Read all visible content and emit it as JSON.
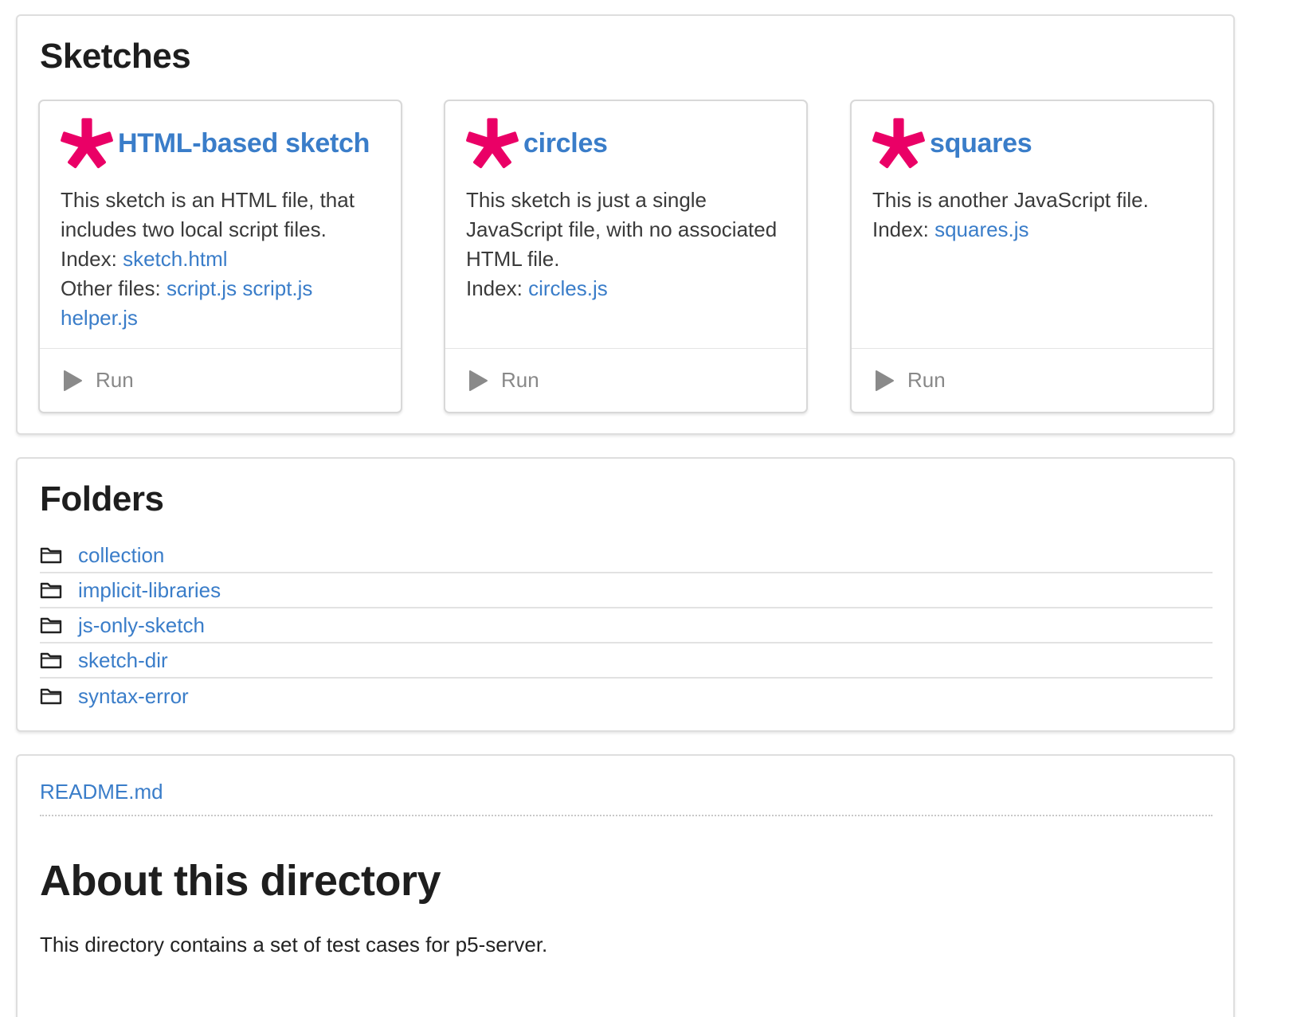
{
  "sketches": {
    "title": "Sketches",
    "cards": [
      {
        "title": "HTML-based sketch",
        "description": "This sketch is an HTML file, that includes two local script files.",
        "index_label": "Index:",
        "index_file": "sketch.html",
        "other_label": "Other files:",
        "other_files": [
          "script.js",
          "script.js",
          "helper.js"
        ],
        "run_label": "Run"
      },
      {
        "title": "circles",
        "description": "This sketch is just a single JavaScript file, with no associated HTML file.",
        "index_label": "Index:",
        "index_file": "circles.js",
        "run_label": "Run"
      },
      {
        "title": "squares",
        "description": "This is another JavaScript file.",
        "index_label": "Index:",
        "index_file": "squares.js",
        "run_label": "Run"
      }
    ]
  },
  "folders": {
    "title": "Folders",
    "items": [
      "collection",
      "implicit-libraries",
      "js-only-sketch",
      "sketch-dir",
      "syntax-error"
    ]
  },
  "readme": {
    "file_link": "README.md",
    "heading": "About this directory",
    "text": "This directory contains a set of test cases for p5-server."
  },
  "colors": {
    "accent_link": "#3a7dc9",
    "asterisk": "#ea0066",
    "run_gray": "#888888"
  },
  "icons": {
    "sketch": "asterisk-icon",
    "run": "play-icon",
    "folder": "folder-icon"
  }
}
